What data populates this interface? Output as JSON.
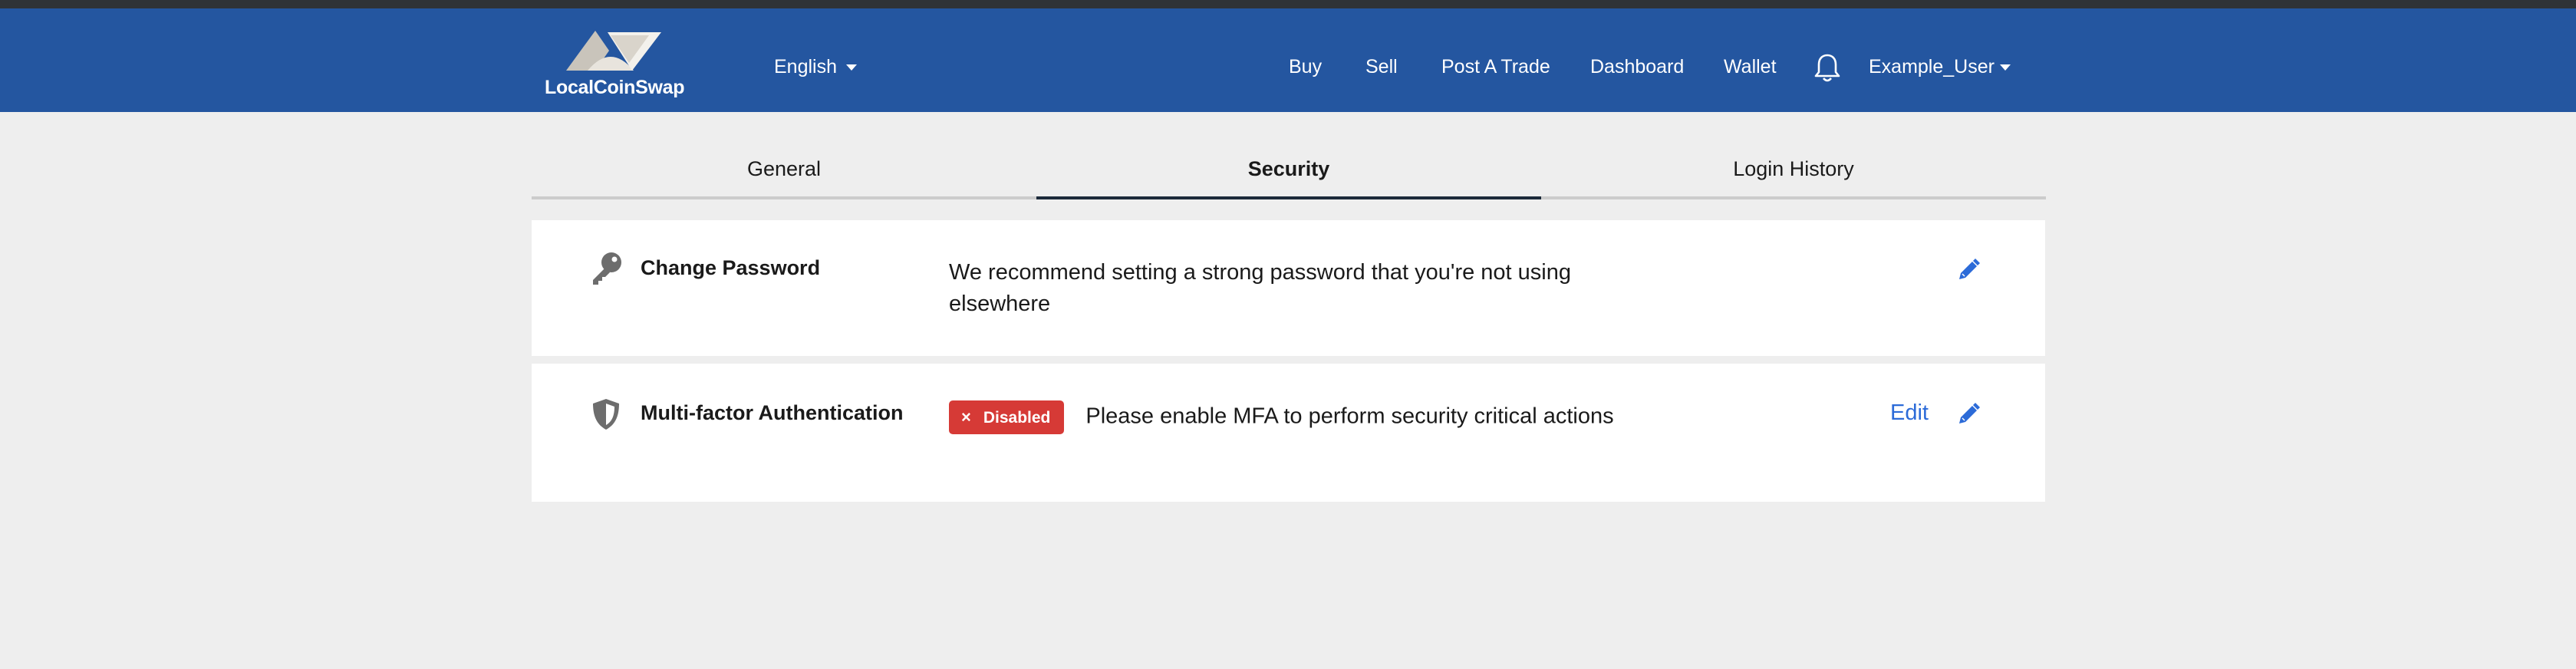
{
  "app": {
    "logo_text": "LocalCoinSwap"
  },
  "nav": {
    "language": "English",
    "links": [
      "Buy",
      "Sell",
      "Post A Trade",
      "Dashboard",
      "Wallet"
    ],
    "username": "Example_User"
  },
  "tabs": [
    "General",
    "Security",
    "Login History"
  ],
  "active_tab": "Security",
  "security": {
    "password": {
      "title": "Change Password",
      "description": "We recommend setting a strong password that you're not using elsewhere"
    },
    "mfa": {
      "title": "Multi-factor Authentication",
      "status": "Disabled",
      "status_icon": "×",
      "description": "Please enable MFA to perform security critical actions",
      "edit_label": "Edit"
    }
  },
  "colors": {
    "navbar": "#2456a0",
    "accent": "#2c6bd8",
    "danger": "#d63a36"
  }
}
